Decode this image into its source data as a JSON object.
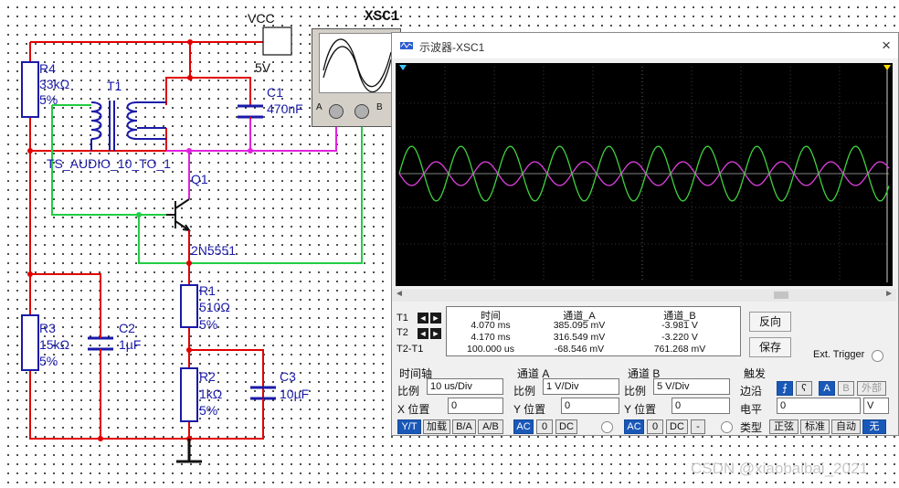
{
  "schematic": {
    "vcc_label": "VCC",
    "vcc_value": "5V",
    "r4": {
      "name": "R4",
      "value": "33kΩ",
      "tol": "5%"
    },
    "t1": {
      "name": "T1",
      "model": "TS_AUDIO_10_TO_1"
    },
    "c1": {
      "name": "C1",
      "value": "470nF"
    },
    "q1": {
      "name": "Q1",
      "model": "2N5551"
    },
    "r1": {
      "name": "R1",
      "value": "510Ω",
      "tol": "5%"
    },
    "r2": {
      "name": "R2",
      "value": "1kΩ",
      "tol": "5%"
    },
    "r3": {
      "name": "R3",
      "value": "15kΩ",
      "tol": "5%"
    },
    "c2": {
      "name": "C2",
      "value": "1µF"
    },
    "c3": {
      "name": "C3",
      "value": "10µF"
    },
    "scope_name": "XSC1",
    "port_a": "A",
    "port_b": "B",
    "colors": {
      "wire_red": "#e00000",
      "wire_green": "#22cc44",
      "wire_magenta": "#e020e0",
      "component": "#1a1aa8"
    }
  },
  "scope_window": {
    "title": "示波器-XSC1",
    "close": "×",
    "trace_colors": {
      "a": "#e040e0",
      "b": "#40d040"
    },
    "cursor_labels": {
      "t1": "T1",
      "t2": "T2",
      "diff": "T2-T1"
    },
    "measurement": {
      "headers": [
        "时间",
        "通道_A",
        "通道_B"
      ],
      "rows": [
        [
          "4.070 ms",
          "385.095 mV",
          "-3.981 V"
        ],
        [
          "4.170 ms",
          "316.549 mV",
          "-3.220 V"
        ],
        [
          "100.000 us",
          "-68.546 mV",
          "761.268 mV"
        ]
      ]
    },
    "reverse_button": "反向",
    "save_button": "保存",
    "ext_trigger": "Ext. Trigger",
    "timebase": {
      "title": "时间轴",
      "scale_label": "比例",
      "scale_value": "10 us/Div",
      "pos_label": "X 位置",
      "pos_value": "0",
      "modes": [
        "Y/T",
        "加载",
        "B/A",
        "A/B"
      ]
    },
    "channel_a": {
      "title": "通道 A",
      "scale_label": "比例",
      "scale_value": "1  V/Div",
      "pos_label": "Y 位置",
      "pos_value": "0",
      "coupling": [
        "AC",
        "0",
        "DC"
      ]
    },
    "channel_b": {
      "title": "通道 B",
      "scale_label": "比例",
      "scale_value": "5  V/Div",
      "pos_label": "Y 位置",
      "pos_value": "0",
      "coupling": [
        "AC",
        "0",
        "DC",
        "-"
      ]
    },
    "trigger": {
      "title": "触发",
      "edge_label": "边沿",
      "edge_buttons": [
        "A",
        "B",
        "外部"
      ],
      "level_label": "电平",
      "level_value": "0",
      "level_unit": "V",
      "type_label": "类型",
      "type_buttons": [
        "正弦",
        "标准",
        "自动",
        "无"
      ]
    }
  },
  "watermark": "CSDN @xiaobaibai_2021"
}
